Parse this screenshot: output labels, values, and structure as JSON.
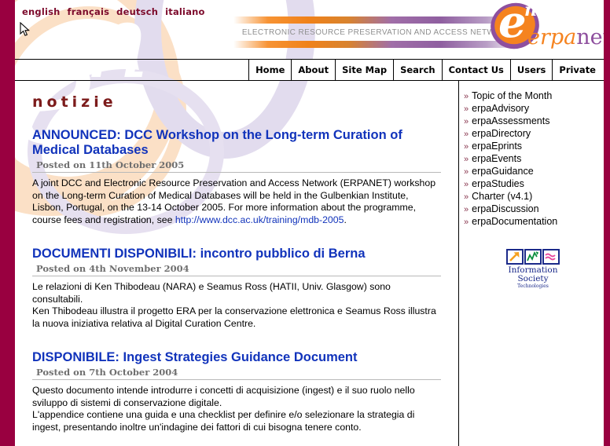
{
  "frame": {
    "border_color": "#990040"
  },
  "header": {
    "languages": [
      {
        "label": "english"
      },
      {
        "label": "français"
      },
      {
        "label": "deutsch"
      },
      {
        "label": "italiano"
      }
    ],
    "tagline": "ELECTRONIC RESOURCE PRESERVATION AND ACCESS NETWORK",
    "logo": {
      "mark_letter": "e",
      "mark_superscript": "n",
      "word_orange": "erpa",
      "word_purple": "net",
      "orange": "#f5831f",
      "purple": "#8e4f9e"
    }
  },
  "nav": {
    "items": [
      {
        "label": "Home"
      },
      {
        "label": "About"
      },
      {
        "label": "Site Map"
      },
      {
        "label": "Search"
      },
      {
        "label": "Contact Us"
      },
      {
        "label": "Users"
      },
      {
        "label": "Private"
      }
    ]
  },
  "main": {
    "page_title": "notizie",
    "articles": [
      {
        "title": "ANNOUNCED: DCC Workshop on the Long-term Curation of Medical Databases",
        "date": "Posted on 11th October 2005",
        "body_before_link": "A joint DCC and Electronic Resource Preservation and Access Network (ERPANET) workshop on the Long-term Curation of Medical Databases will be held in the Gulbenkian Institute, Lisbon, Portugal, on the 13-14 October 2005. For more information about the programme, course fees and registration, see ",
        "link_text": "http://www.dcc.ac.uk/training/mdb-2005",
        "body_after_link": "."
      },
      {
        "title": "DOCUMENTI DISPONIBILI: incontro pubblico di Berna",
        "date": "Posted on 4th November 2004",
        "body_before_link": "Le relazioni di Ken Thibodeau (NARA) e Seamus Ross (HATII, Univ. Glasgow) sono consultabili.\nKen Thibodeau illustra il progetto ERA per la conservazione elettronica e Seamus Ross illustra la nuova iniziativa relativa al Digital Curation Centre.",
        "link_text": "",
        "body_after_link": ""
      },
      {
        "title": "DISPONIBILE: Ingest Strategies Guidance Document",
        "date": "Posted on 7th October 2004",
        "body_before_link": "Questo documento intende introdurre i concetti di acquisizione (ingest) e il suo ruolo nello sviluppo di sistemi di conservazione digitale.\nL'appendice contiene una guida e una checklist per definire e/o selezionare la strategia di ingest, presentando inoltre un'indagine dei fattori di cui bisogna tenere conto.",
        "link_text": "",
        "body_after_link": ""
      }
    ],
    "link_color": "#1133bb",
    "title_color": "#7c1b1b"
  },
  "sidebar": {
    "marker": "»",
    "items": [
      {
        "label": "Topic of the Month"
      },
      {
        "label": "erpaAdvisory"
      },
      {
        "label": "erpaAssessments"
      },
      {
        "label": "erpaDirectory"
      },
      {
        "label": "erpaEprints"
      },
      {
        "label": "erpaEvents"
      },
      {
        "label": "erpaGuidance"
      },
      {
        "label": "erpaStudies"
      },
      {
        "label": "Charter (v4.1)"
      },
      {
        "label": "erpaDiscussion"
      },
      {
        "label": "erpaDocumentation"
      }
    ],
    "ist_logo": {
      "caption": "Information Society",
      "subcaption": "Technologies",
      "box_border_color": "#1b2a8a",
      "arrow_color": "#f5a01f",
      "chart_color": "#0a8f3c",
      "wave_color": "#e8479c"
    }
  }
}
